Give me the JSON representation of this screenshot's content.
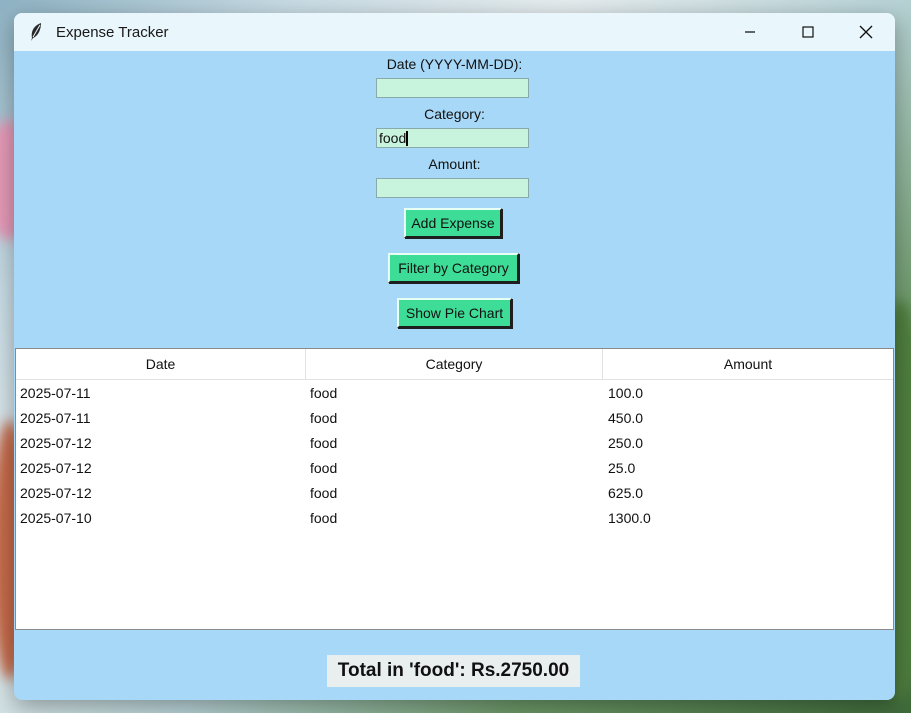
{
  "window": {
    "title": "Expense Tracker"
  },
  "form": {
    "date_label": "Date (YYYY-MM-DD):",
    "date_value": "",
    "category_label": "Category:",
    "category_value": "food",
    "amount_label": "Amount:",
    "amount_value": "",
    "add_button": "Add Expense",
    "filter_button": "Filter by Category",
    "pie_button": "Show Pie Chart"
  },
  "table": {
    "columns": [
      "Date",
      "Category",
      "Amount"
    ],
    "rows": [
      [
        "2025-07-11",
        "food",
        "100.0"
      ],
      [
        "2025-07-11",
        "food",
        "450.0"
      ],
      [
        "2025-07-12",
        "food",
        "250.0"
      ],
      [
        "2025-07-12",
        "food",
        "25.0"
      ],
      [
        "2025-07-12",
        "food",
        "625.0"
      ],
      [
        "2025-07-10",
        "food",
        "1300.0"
      ]
    ]
  },
  "total_text": "Total in 'food': Rs.2750.00",
  "colors": {
    "window_bg": "#a8d8f8",
    "entry_bg": "#c8f4de",
    "button_bg": "#3ddc97",
    "titlebar_bg": "#e9f6fb"
  }
}
